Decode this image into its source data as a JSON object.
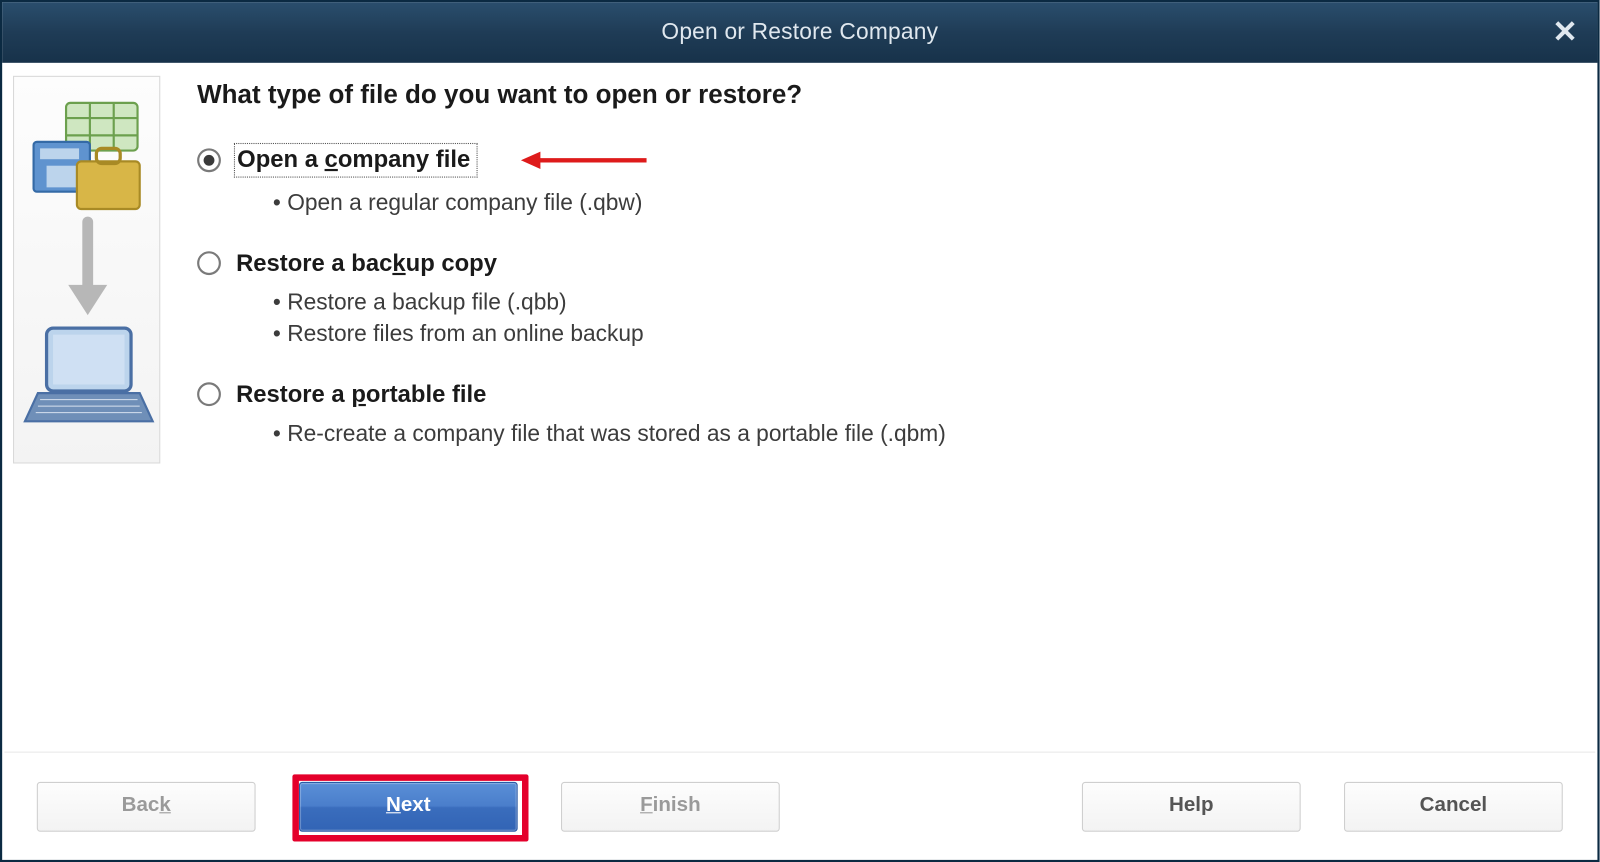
{
  "title": "Open or Restore Company",
  "heading": "What type of file do you want to open or restore?",
  "options": [
    {
      "label_pre": "Open a ",
      "label_key": "c",
      "label_post": "ompany file",
      "selected": true,
      "focused": true,
      "sub": [
        "Open a regular company file (.qbw)"
      ]
    },
    {
      "label_pre": "Restore a bac",
      "label_key": "k",
      "label_post": "up copy",
      "selected": false,
      "focused": false,
      "sub": [
        "Restore a backup file (.qbb)",
        "Restore files from an online backup"
      ]
    },
    {
      "label_pre": "Restore a ",
      "label_key": "p",
      "label_post": "ortable file",
      "selected": false,
      "focused": false,
      "sub": [
        "Re-create a company file that was stored as a portable file (.qbm)"
      ]
    }
  ],
  "buttons": {
    "back": {
      "pre": "Bac",
      "key": "k",
      "post": "",
      "enabled": false
    },
    "next": {
      "pre": "",
      "key": "N",
      "post": "ext",
      "enabled": true,
      "primary": true,
      "highlighted": true
    },
    "finish": {
      "pre": "",
      "key": "F",
      "post": "inish",
      "enabled": false
    },
    "help": {
      "text": "Help",
      "enabled": true
    },
    "cancel": {
      "text": "Cancel",
      "enabled": true
    }
  },
  "annotation_arrow": true
}
